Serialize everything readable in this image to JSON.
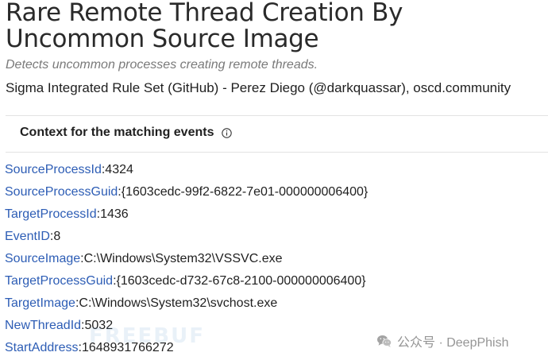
{
  "rule": {
    "title": "Rare Remote Thread Creation By Uncommon Source Image",
    "description": "Detects uncommon processes creating remote threads.",
    "source": "Sigma Integrated Rule Set (GitHub) - Perez Diego (@darkquassar), oscd.community"
  },
  "context": {
    "heading": "Context for the matching events",
    "info_icon": "info-circle-icon",
    "separator": ":",
    "fields": [
      {
        "key": "SourceProcessId",
        "value": "4324"
      },
      {
        "key": "SourceProcessGuid",
        "value": "{1603cedc-99f2-6822-7e01-000000006400}"
      },
      {
        "key": "TargetProcessId",
        "value": "1436"
      },
      {
        "key": "EventID",
        "value": "8"
      },
      {
        "key": "SourceImage",
        "value": "C:\\Windows\\System32\\VSSVC.exe"
      },
      {
        "key": "TargetProcessGuid",
        "value": "{1603cedc-d732-67c8-2100-000000006400}"
      },
      {
        "key": "TargetImage",
        "value": "C:\\Windows\\System32\\svchost.exe"
      },
      {
        "key": "NewThreadId",
        "value": "5032"
      },
      {
        "key": "StartAddress",
        "value": "1648931766272"
      }
    ]
  },
  "watermark": {
    "text": "公众号 · DeepPhish",
    "icon": "wechat-icon",
    "faint_text": "FREEBUF"
  },
  "colors": {
    "field_key": "#2d5db5",
    "text": "#1f1f1f",
    "description": "#7a7a7a",
    "divider": "#e2e2e2"
  }
}
